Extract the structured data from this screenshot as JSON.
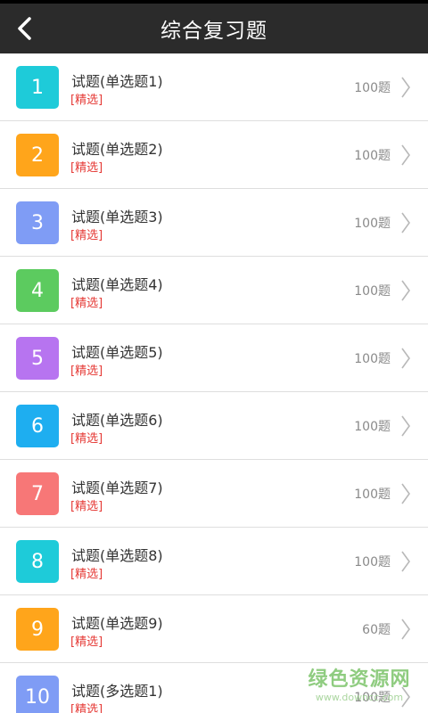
{
  "header": {
    "title": "综合复习题",
    "back_icon": "chevron-left-icon"
  },
  "list": {
    "items": [
      {
        "num": "1",
        "title": "试题(单选题1)",
        "tag": "[精选]",
        "count": "100题",
        "color": "#1ecbd9"
      },
      {
        "num": "2",
        "title": "试题(单选题2)",
        "tag": "[精选]",
        "count": "100题",
        "color": "#ffa51b"
      },
      {
        "num": "3",
        "title": "试题(单选题3)",
        "tag": "[精选]",
        "count": "100题",
        "color": "#7f9cf5"
      },
      {
        "num": "4",
        "title": "试题(单选题4)",
        "tag": "[精选]",
        "count": "100题",
        "color": "#5ccb5f"
      },
      {
        "num": "5",
        "title": "试题(单选题5)",
        "tag": "[精选]",
        "count": "100题",
        "color": "#b774f0"
      },
      {
        "num": "6",
        "title": "试题(单选题6)",
        "tag": "[精选]",
        "count": "100题",
        "color": "#1eaef0"
      },
      {
        "num": "7",
        "title": "试题(单选题7)",
        "tag": "[精选]",
        "count": "100题",
        "color": "#f77777"
      },
      {
        "num": "8",
        "title": "试题(单选题8)",
        "tag": "[精选]",
        "count": "100题",
        "color": "#1ecbd9"
      },
      {
        "num": "9",
        "title": "试题(单选题9)",
        "tag": "[精选]",
        "count": "60题",
        "color": "#ffa51b"
      },
      {
        "num": "10",
        "title": "试题(多选题1)",
        "tag": "[精选]",
        "count": "100题",
        "color": "#7f9cf5"
      }
    ]
  },
  "watermark": {
    "text": "绿色资源网",
    "url": "www.downcc.com"
  }
}
